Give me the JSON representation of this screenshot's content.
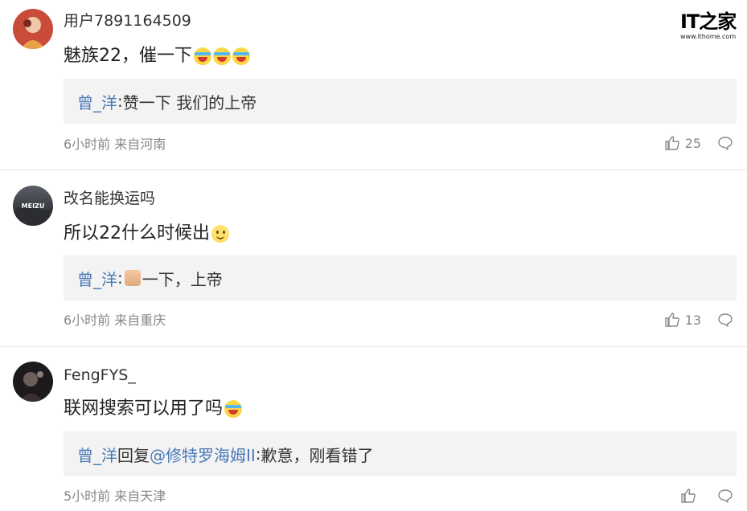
{
  "watermark": {
    "logo": "IT之家",
    "url": "www.ithome.com"
  },
  "comments": [
    {
      "username": "用户7891164509",
      "content": "魅族22，催一下",
      "emojis": [
        "cry-emoji",
        "cry-emoji",
        "cry-emoji"
      ],
      "reply": {
        "user": "曾_洋",
        "sep": ":",
        "text": "赞一下 我们的上帝"
      },
      "meta": "6小时前 来自河南",
      "likes": "25"
    },
    {
      "username": "改名能换运吗",
      "avatar_text": "MEIZU",
      "content": "所以22什么时候出",
      "emojis": [
        "smile-emoji"
      ],
      "reply": {
        "user": "曾_洋",
        "sep": ":",
        "text": "一下，上帝"
      },
      "meta": "6小时前 来自重庆",
      "likes": "13"
    },
    {
      "username": "FengFYS_",
      "content": "联网搜索可以用了吗",
      "emojis": [
        "cry-emoji"
      ],
      "reply": {
        "user": "曾_洋",
        "reply_word": "回复",
        "mention": "@修特罗海姆II",
        "sep": ":",
        "text": "歉意，刚看错了"
      },
      "meta": "5小时前 来自天津",
      "likes": ""
    }
  ],
  "colors": {
    "link": "#4a7ab8",
    "meta": "#888888",
    "reply_bg": "#f3f3f3"
  }
}
